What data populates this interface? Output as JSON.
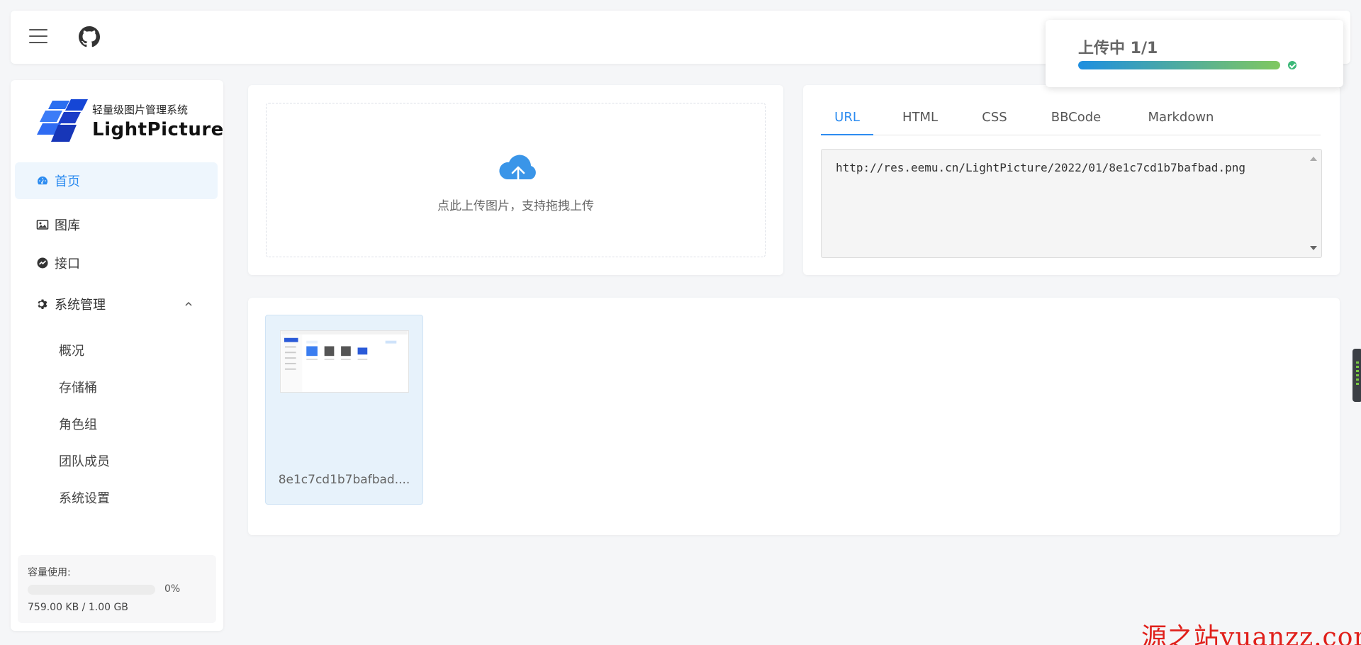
{
  "header": {
    "menu_icon": "hamburger-icon",
    "github_icon": "github-icon"
  },
  "toast": {
    "title": "上传中 1/1",
    "progress": 1.0,
    "status_icon": "check-circle-icon",
    "colors": {
      "start": "#1e8fe0",
      "end": "#80c85f",
      "check": "#3cb878"
    }
  },
  "sidebar": {
    "logo": {
      "subtitle": "轻量级图片管理系统",
      "name": "LightPicture"
    },
    "items": [
      {
        "label": "首页",
        "icon": "dashboard-icon",
        "active": true
      },
      {
        "label": "图库",
        "icon": "image-icon",
        "active": false
      },
      {
        "label": "接口",
        "icon": "api-icon",
        "active": false
      },
      {
        "label": "系统管理",
        "icon": "gear-icon",
        "active": false,
        "expanded": true
      }
    ],
    "subitems": [
      {
        "label": "概况"
      },
      {
        "label": "存储桶"
      },
      {
        "label": "角色组"
      },
      {
        "label": "团队成员"
      },
      {
        "label": "系统设置"
      }
    ],
    "usage": {
      "label": "容量使用:",
      "percent": "0%",
      "value": "759.00 KB / 1.00 GB"
    }
  },
  "upload": {
    "hint": "点此上传图片，支持拖拽上传",
    "icon": "cloud-upload-icon"
  },
  "code_panel": {
    "tabs": [
      {
        "label": "URL",
        "active": true
      },
      {
        "label": "HTML",
        "active": false
      },
      {
        "label": "CSS",
        "active": false
      },
      {
        "label": "BBCode",
        "active": false
      },
      {
        "label": "Markdown",
        "active": false
      }
    ],
    "content": "http://res.eemu.cn/LightPicture/2022/01/8e1c7cd1b7bafbad.png"
  },
  "gallery": {
    "items": [
      {
        "name": "8e1c7cd1b7bafbad...."
      }
    ]
  },
  "watermark": "源之站yuanzz.com",
  "colors": {
    "accent": "#2d8cf0",
    "background": "#f5f6f8",
    "watermark": "#e0201b"
  }
}
